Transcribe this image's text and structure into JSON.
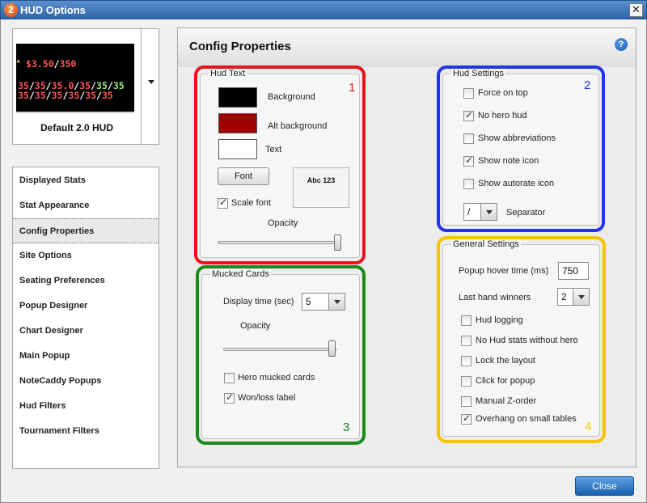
{
  "window": {
    "title": "HUD Options",
    "app_icon_glyph": "2",
    "close_glyph": "✕"
  },
  "hud_card": {
    "name": "Default 2.0 HUD",
    "preview": {
      "row1": [
        "$3.50",
        "/",
        "350"
      ],
      "row2": [
        "35",
        "/",
        "35",
        "/",
        "35.0",
        "/",
        "35",
        "/",
        "35",
        "/",
        "35"
      ],
      "row3": [
        "35",
        "/",
        "35",
        "/",
        "35",
        "/",
        "35",
        "/",
        "35",
        "/",
        "35"
      ]
    }
  },
  "nav": {
    "items": [
      "Displayed Stats",
      "Stat Appearance",
      "Config Properties",
      "Site Options",
      "Seating Preferences",
      "Popup Designer",
      "Chart Designer",
      "Main Popup",
      "NoteCaddy Popups",
      "Hud Filters",
      "Tournament Filters"
    ],
    "active": "Config Properties"
  },
  "panel": {
    "title": "Config Properties",
    "help_glyph": "?"
  },
  "hud_text": {
    "title": "Hud Text",
    "number": "1",
    "background_label": "Background",
    "background_color": "#000000",
    "alt_background_label": "Alt background",
    "alt_background_color": "#a00000",
    "text_label": "Text",
    "text_color": "#ffffff",
    "font_button": "Font",
    "sample_text": "Abc 123",
    "scale_font_label": "Scale font",
    "scale_font_checked": true,
    "opacity_label": "Opacity",
    "opacity_value": 1.0
  },
  "hud_settings": {
    "title": "Hud Settings",
    "number": "2",
    "options": [
      {
        "label": "Force on top",
        "checked": false
      },
      {
        "label": "No hero hud",
        "checked": true
      },
      {
        "label": "Show abbreviations",
        "checked": false
      },
      {
        "label": "Show note icon",
        "checked": true
      },
      {
        "label": "Show autorate icon",
        "checked": false
      }
    ],
    "separator_value": "/",
    "separator_label": "Separator"
  },
  "mucked_cards": {
    "title": "Mucked Cards",
    "number": "3",
    "display_time_label": "Display time (sec)",
    "display_time_value": "5",
    "opacity_label": "Opacity",
    "opacity_value": 1.0,
    "options": [
      {
        "label": "Hero mucked cards",
        "checked": false
      },
      {
        "label": "Won/loss label",
        "checked": true
      }
    ]
  },
  "general_settings": {
    "title": "General Settings",
    "number": "4",
    "popup_hover_label": "Popup hover time (ms)",
    "popup_hover_value": "750",
    "last_hand_label": "Last hand winners",
    "last_hand_value": "2",
    "options": [
      {
        "label": "Hud logging",
        "checked": false
      },
      {
        "label": "No Hud stats without hero",
        "checked": false
      },
      {
        "label": "Lock the layout",
        "checked": false
      },
      {
        "label": "Click for popup",
        "checked": false
      },
      {
        "label": "Manual Z-order",
        "checked": false
      },
      {
        "label": "Overhang on small tables",
        "checked": true
      }
    ]
  },
  "footer": {
    "close_label": "Close"
  },
  "colors": {
    "red": "#e8141b",
    "blue": "#1f35e6",
    "green": "#1a8a1a",
    "yellow": "#f4c400"
  }
}
